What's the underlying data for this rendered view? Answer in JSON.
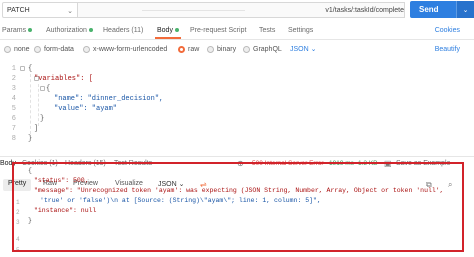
{
  "request": {
    "method": "PATCH",
    "url_visible": "v1/tasks/:taskId/complete",
    "send_label": "Send"
  },
  "request_tabs": [
    {
      "label": "Params",
      "dot": true
    },
    {
      "label": "Authorization",
      "dot": true
    },
    {
      "label": "Headers (11)"
    },
    {
      "label": "Body",
      "active": true,
      "dot": true
    },
    {
      "label": "Pre-request Script"
    },
    {
      "label": "Tests"
    },
    {
      "label": "Settings"
    }
  ],
  "cookies_label": "Cookies",
  "body_types": [
    {
      "label": "none"
    },
    {
      "label": "form-data"
    },
    {
      "label": "x-www-form-urlencoded"
    },
    {
      "label": "raw",
      "selected": true
    },
    {
      "label": "binary"
    },
    {
      "label": "GraphQL"
    }
  ],
  "raw_format": "JSON",
  "beautify_label": "Beautify",
  "editor": {
    "line_numbers": [
      "1",
      "2",
      "3",
      "4",
      "5",
      "6",
      "7",
      "8"
    ],
    "lines": [
      "{",
      "\"variables\": [",
      "{",
      "\"name\": \"dinner_decision\",",
      "\"value\": \"ayam\"",
      "}",
      "]",
      "}"
    ]
  },
  "response_tabs": [
    {
      "label": "Body",
      "active": true
    },
    {
      "label": "Cookies (1)"
    },
    {
      "label": "Headers (15)"
    },
    {
      "label": "Test Results"
    }
  ],
  "response_status": "500 Internal Server Error",
  "response_time": "1919 ms",
  "response_size": "1.3 KB",
  "save_example_label": "Save as Example",
  "view_modes": [
    {
      "label": "Pretty",
      "active": true
    },
    {
      "label": "Raw"
    },
    {
      "label": "Preview"
    },
    {
      "label": "Visualize"
    }
  ],
  "response_format": "JSON",
  "response_body": {
    "line_numbers": [
      "1",
      "2",
      "3",
      "4",
      "5"
    ],
    "lines": [
      "{",
      "\"status\": 500,",
      "\"message\": \"Unrecognized token 'ayam': was expecting (JSON String, Number, Array, Object or token 'null',",
      "'true' or 'false')\\n at [Source: (String)\\\"ayam\\\"; line: 1, column: 5]\",",
      "\"instance\": null",
      "}"
    ]
  },
  "colors": {
    "accent_orange": "#f26b3a",
    "send_blue": "#2e7fe0",
    "error_red": "#d83b3b",
    "highlight_red": "#d2232a",
    "ok_green": "#3b9b5a"
  }
}
